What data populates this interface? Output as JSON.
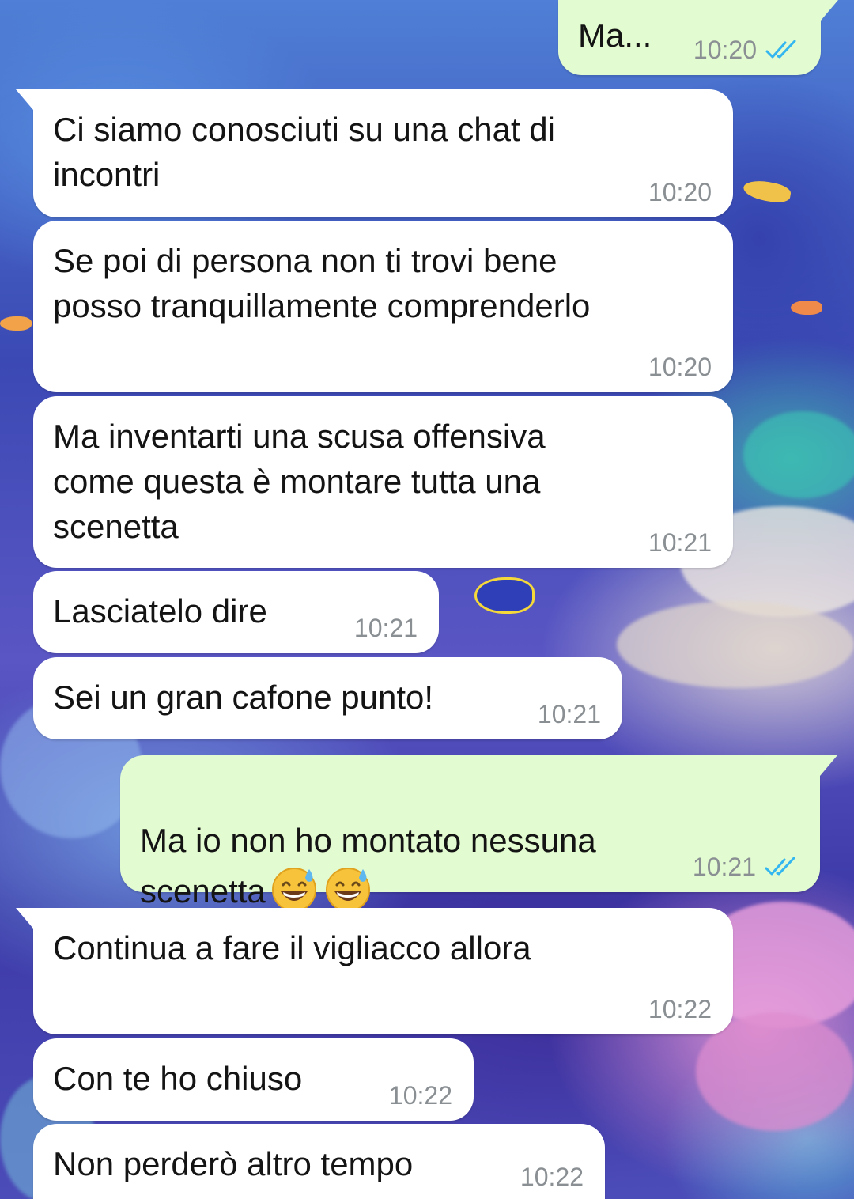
{
  "colors": {
    "incoming_bubble": "#ffffff",
    "outgoing_bubble": "#e3fbd0",
    "text": "#141414",
    "timestamp": "#8a8f93",
    "read_ticks": "#34b7f1"
  },
  "messages": [
    {
      "direction": "outgoing",
      "text": "Ma...",
      "time": "10:20",
      "status": "read",
      "status_icon": "double-check-icon"
    },
    {
      "direction": "incoming",
      "text": "Ci siamo conosciuti su una chat di\nincontri",
      "time": "10:20"
    },
    {
      "direction": "incoming",
      "text": "Se poi di persona non ti trovi bene\nposso tranquillamente comprenderlo",
      "time": "10:20"
    },
    {
      "direction": "incoming",
      "text": "Ma inventarti una scusa offensiva\ncome questa è montare tutta una\nscenetta",
      "time": "10:21"
    },
    {
      "direction": "incoming",
      "text": "Lasciatelo dire",
      "time": "10:21"
    },
    {
      "direction": "incoming",
      "text": "Sei un gran cafone punto!",
      "time": "10:21"
    },
    {
      "direction": "outgoing",
      "text": "Ma io non ho montato nessuna\nscenetta",
      "emoji": [
        "grinning-face-with-sweat-emoji",
        "grinning-face-with-sweat-emoji"
      ],
      "time": "10:21",
      "status": "read",
      "status_icon": "double-check-icon"
    },
    {
      "direction": "incoming",
      "text": "Continua a fare il vigliacco allora",
      "time": "10:22"
    },
    {
      "direction": "incoming",
      "text": "Con te ho chiuso",
      "time": "10:22"
    },
    {
      "direction": "incoming",
      "text": "Non perderò altro tempo",
      "time": "10:22"
    }
  ]
}
